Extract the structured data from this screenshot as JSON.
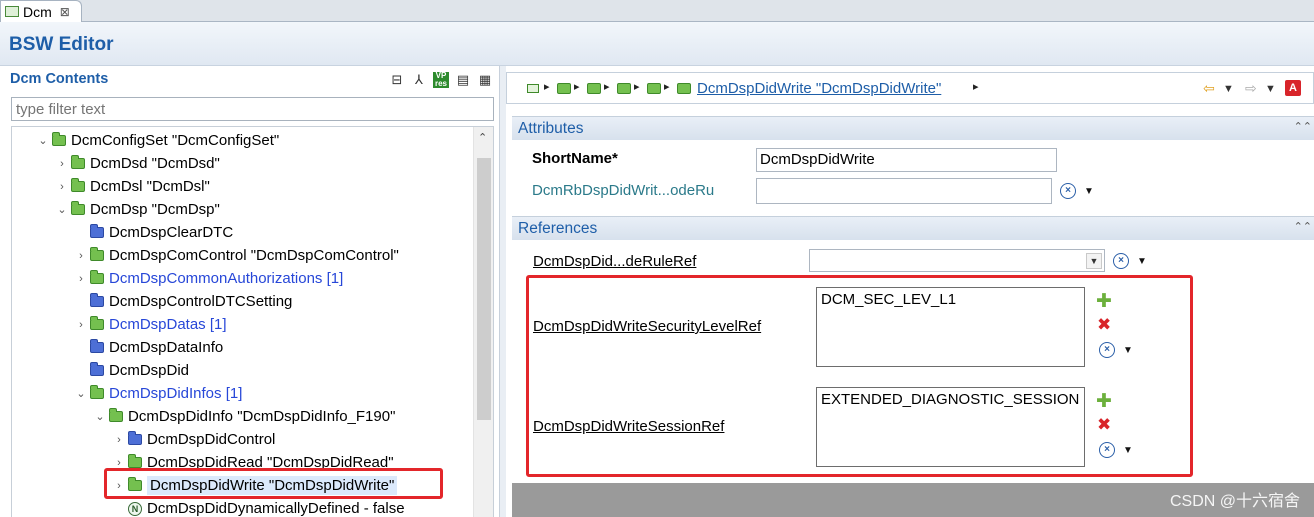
{
  "tab": {
    "label": "Dcm",
    "close": "⊠"
  },
  "editor": {
    "title": "BSW Editor"
  },
  "left": {
    "title": "Dcm Contents",
    "filter_placeholder": "type filter text",
    "toolbar": [
      "collapse-all-icon",
      "tree-structure-icon",
      "vp-res-icon",
      "document-icon",
      "table-view-icon"
    ],
    "vp_label": "VP res"
  },
  "tree": [
    {
      "label": "DcmConfigSet \"DcmConfigSet\"",
      "twisty": "⌄",
      "icon": "green"
    },
    {
      "label": "DcmDsd \"DcmDsd\"",
      "twisty": "›",
      "icon": "green"
    },
    {
      "label": "DcmDsl \"DcmDsl\"",
      "twisty": "›",
      "icon": "green"
    },
    {
      "label": "DcmDsp \"DcmDsp\"",
      "twisty": "⌄",
      "icon": "green"
    },
    {
      "label": "DcmDspClearDTC",
      "twisty": "",
      "icon": "blue"
    },
    {
      "label": "DcmDspComControl \"DcmDspComControl\"",
      "twisty": "›",
      "icon": "green"
    },
    {
      "label": "DcmDspCommonAuthorizations [1]",
      "twisty": "›",
      "icon": "green",
      "link": true
    },
    {
      "label": "DcmDspControlDTCSetting",
      "twisty": "",
      "icon": "blue"
    },
    {
      "label": "DcmDspDatas [1]",
      "twisty": "›",
      "icon": "green",
      "link": true
    },
    {
      "label": "DcmDspDataInfo",
      "twisty": "",
      "icon": "blue"
    },
    {
      "label": "DcmDspDid",
      "twisty": "",
      "icon": "blue"
    },
    {
      "label": "DcmDspDidInfos [1]",
      "twisty": "⌄",
      "icon": "green",
      "link": true
    },
    {
      "label": "DcmDspDidInfo \"DcmDspDidInfo_F190\"",
      "twisty": "⌄",
      "icon": "green"
    },
    {
      "label": "DcmDspDidControl",
      "twisty": "›",
      "icon": "blue"
    },
    {
      "label": "DcmDspDidRead \"DcmDspDidRead\"",
      "twisty": "›",
      "icon": "green"
    },
    {
      "label": "DcmDspDidWrite \"DcmDspDidWrite\"",
      "twisty": "›",
      "icon": "green",
      "selected": true
    },
    {
      "label": "DcmDspDidDynamicallyDefined - false",
      "twisty": "",
      "icon": "bool",
      "bool_glyph": "N"
    }
  ],
  "breadcrumb": {
    "current": "DcmDspDidWrite \"DcmDspDidWrite\""
  },
  "attributes": {
    "title": "Attributes",
    "shortname_label": "ShortName*",
    "shortname_value": "DcmDspDidWrite",
    "rb_label": "DcmRbDspDidWrit...odeRu",
    "rb_value": ""
  },
  "references": {
    "title": "References",
    "moderule_label": "DcmDspDid...deRuleRef",
    "moderule_value": "",
    "security_label": "DcmDspDidWriteSecurityLevelRef",
    "security_items": [
      "DCM_SEC_LEV_L1"
    ],
    "session_label": "DcmDspDidWriteSessionRef",
    "session_items": [
      "EXTENDED_DIAGNOSTIC_SESSION"
    ]
  },
  "watermark": "CSDN @十六宿舍",
  "accent": {
    "title_blue": "#1e5ea8",
    "link_blue": "#2747d8",
    "highlight_red": "#e3262a",
    "folder_green": "#74c04f"
  }
}
